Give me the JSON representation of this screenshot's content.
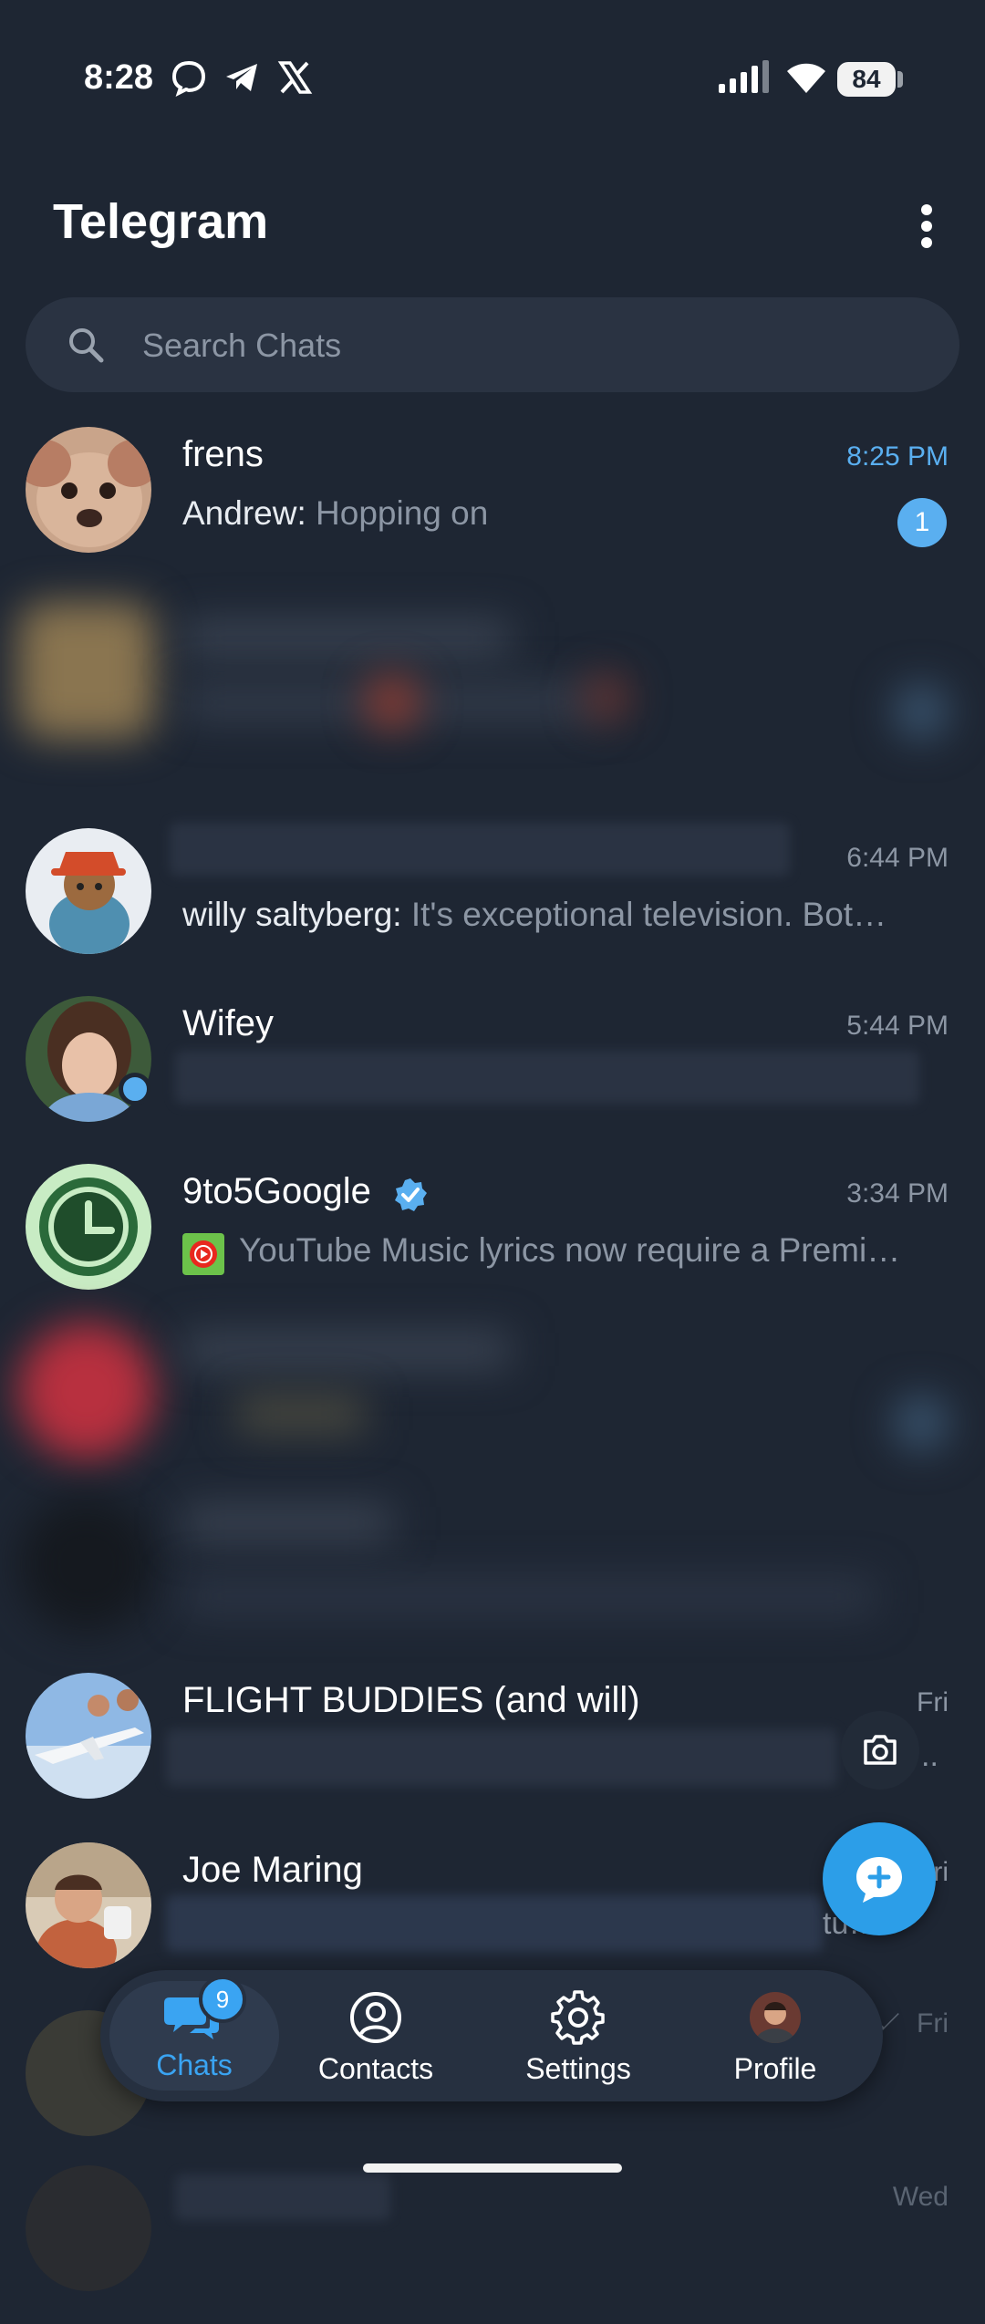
{
  "status_bar": {
    "time": "8:28",
    "battery": "84"
  },
  "app": {
    "title": "Telegram"
  },
  "search": {
    "placeholder": "Search Chats"
  },
  "chats": [
    {
      "name": "frens",
      "time": "8:25 PM",
      "sender": "Andrew:",
      "message": "Hopping on",
      "unread": "1"
    },
    {
      "name": "",
      "time": "6:44 PM",
      "sender": "willy saltyberg:",
      "message": "It's exceptional television. Bot…"
    },
    {
      "name": "Wifey",
      "time": "5:44 PM",
      "online": true
    },
    {
      "name": "9to5Google",
      "verified": true,
      "time": "3:34 PM",
      "message": "YouTube Music lyrics now require a Premi…"
    },
    {
      "name": "FLIGHT BUDDIES (and will)",
      "time": "Fri",
      "message_tail": ".."
    },
    {
      "name": "Joe Maring",
      "time": "Fri",
      "message_tail": "tu…"
    },
    {
      "name": "",
      "time": "Fri"
    },
    {
      "name": "",
      "time": "Wed"
    }
  ],
  "nav": {
    "chats": {
      "label": "Chats",
      "badge": "9"
    },
    "contacts": {
      "label": "Contacts"
    },
    "settings": {
      "label": "Settings"
    },
    "profile": {
      "label": "Profile"
    }
  },
  "colors": {
    "background": "#1e2633",
    "accent": "#3aa4f2",
    "unread": "#5aaff0"
  }
}
